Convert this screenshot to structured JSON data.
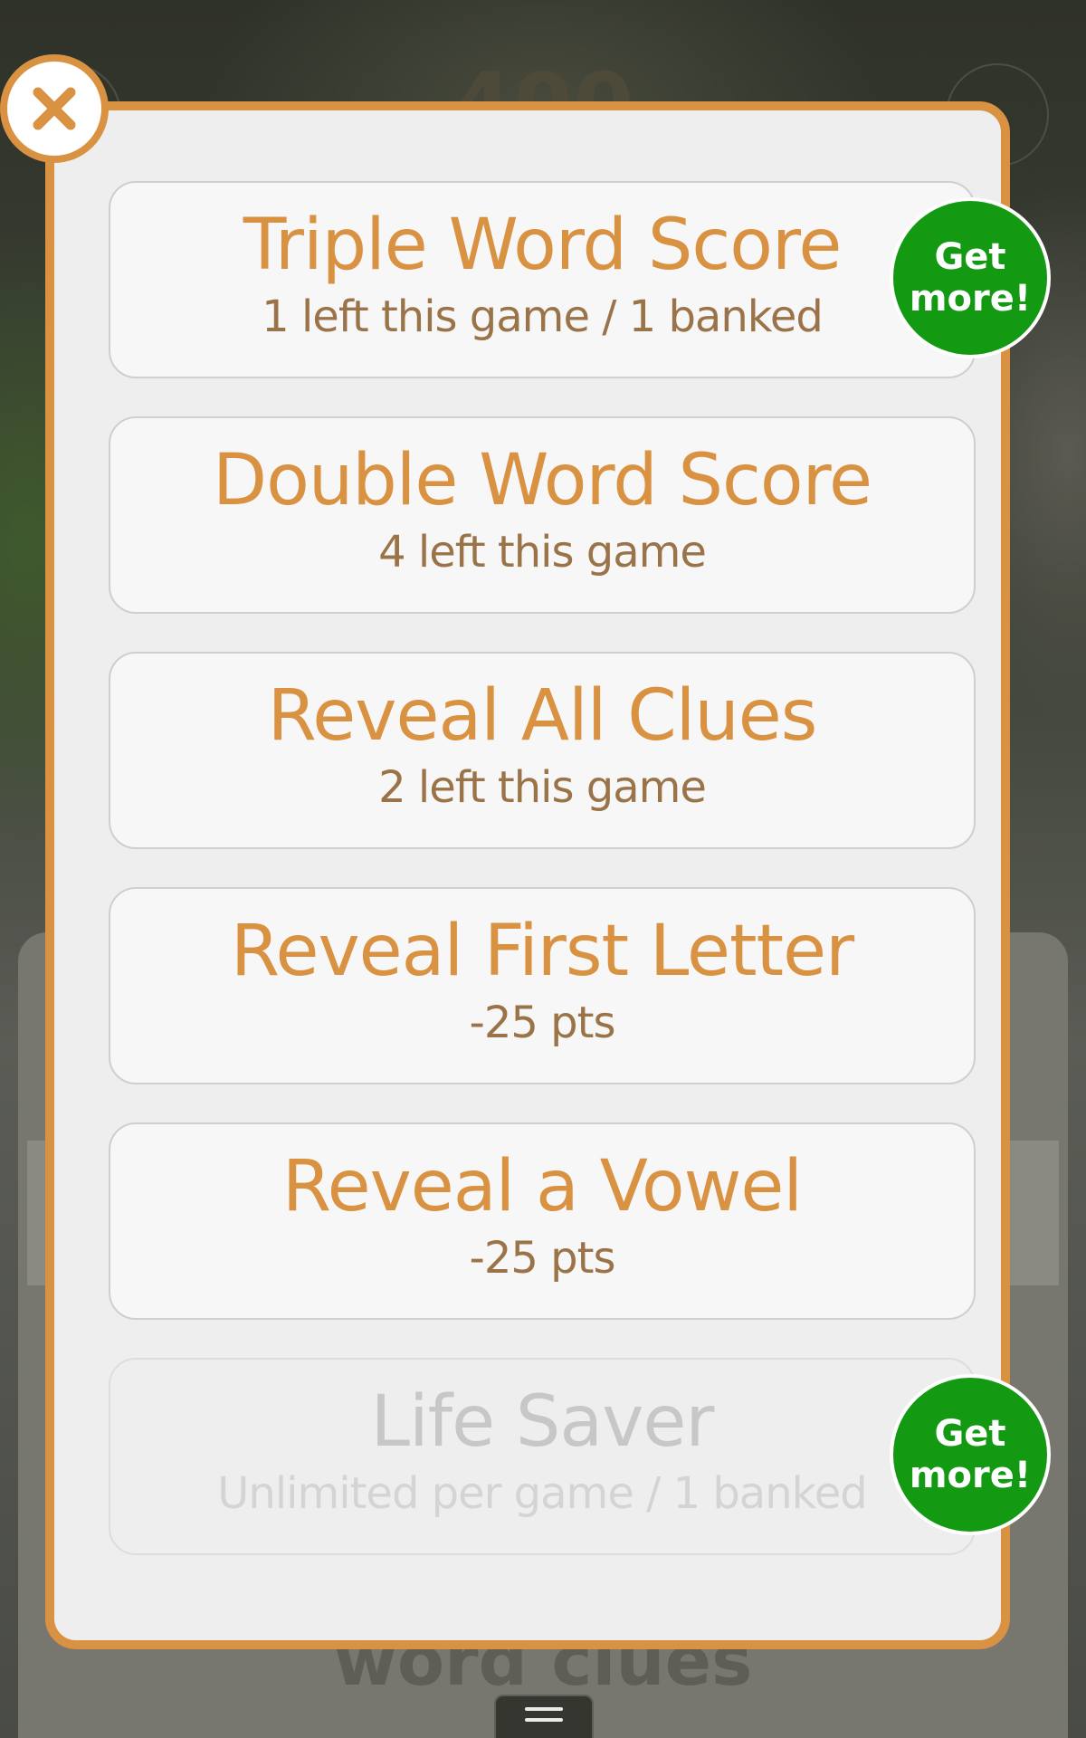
{
  "background": {
    "score": "400",
    "caption": "word clues"
  },
  "modal": {
    "close_icon": "close-icon",
    "accent_color": "#d99142",
    "options": [
      {
        "title": "Triple Word Score",
        "subtitle": "1 left this game / 1 banked",
        "enabled": true
      },
      {
        "title": "Double Word Score",
        "subtitle": "4 left this game",
        "enabled": true
      },
      {
        "title": "Reveal All Clues",
        "subtitle": "2 left this game",
        "enabled": true
      },
      {
        "title": "Reveal First Letter",
        "subtitle": "-25 pts",
        "enabled": true
      },
      {
        "title": "Reveal a Vowel",
        "subtitle": "-25 pts",
        "enabled": true
      },
      {
        "title": "Life Saver",
        "subtitle": "Unlimited per game / 1 banked",
        "enabled": false
      }
    ],
    "get_more": {
      "line1": "Get",
      "line2": "more!",
      "color": "#149a12"
    }
  },
  "menu_icon": "hamburger-menu-icon"
}
